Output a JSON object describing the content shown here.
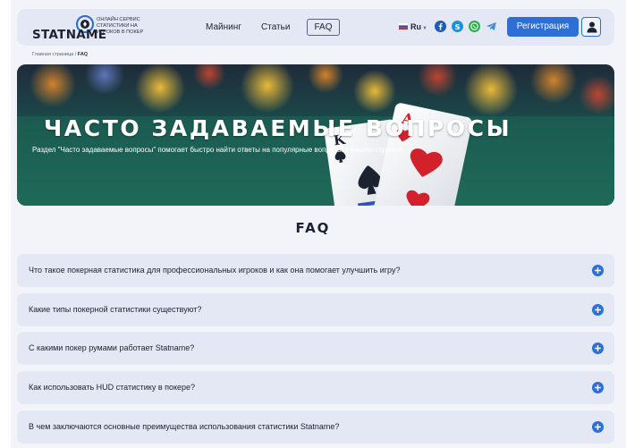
{
  "header": {
    "logo_text": "STATNAME",
    "tagline": "ОНЛАЙН СЕРВИС СТАТИСТИКИ НА ИГРОКОВ В ПОКЕР",
    "nav": {
      "mining": "Майнинг",
      "articles": "Статьи",
      "faq": "FAQ"
    },
    "language": "Ru",
    "register_label": "Регистрация",
    "colors": {
      "accent": "#2d6fd6",
      "header_bg": "#e3e8f4"
    },
    "social_icons": [
      "facebook-icon",
      "skype-icon",
      "whatsapp-icon",
      "telegram-icon"
    ]
  },
  "breadcrumb": {
    "home": "Главная страница",
    "separator": "/",
    "current": "FAQ"
  },
  "hero": {
    "title": "ЧАСТО ЗАДАВАЕМЫЕ ВОПРОСЫ",
    "subtitle": "Раздел \"Часто задаваемые вопросы\" помогает быстро найти ответы на популярные вопросы о нашем сервисе."
  },
  "faq": {
    "heading": "FAQ",
    "items": [
      {
        "question": "Что такое покерная статистика для профессиональных игроков и как она помогает улучшить игру?"
      },
      {
        "question": "Какие типы покерной статистики существуют?"
      },
      {
        "question": "С какими покер румами работает Statname?"
      },
      {
        "question": "Как использовать HUD статистику в покере?"
      },
      {
        "question": "В чем заключаются основные преимущества использования статистики Statname?"
      }
    ]
  }
}
